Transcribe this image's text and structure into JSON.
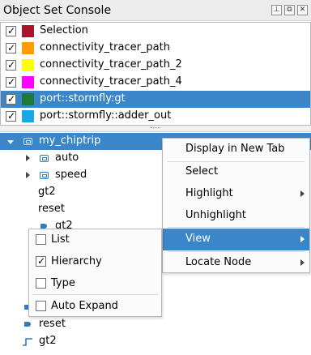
{
  "panel": {
    "title": "Object Set Console",
    "pin_glyph": "⊥",
    "float_glyph": "⧉",
    "close_glyph": "✕"
  },
  "object_sets": [
    {
      "label": "Selection",
      "checked": true,
      "color": "#a8142a",
      "selected": false
    },
    {
      "label": "connectivity_tracer_path",
      "checked": true,
      "color": "#ff9c00",
      "selected": false
    },
    {
      "label": "connectivity_tracer_path_2",
      "checked": true,
      "color": "#ffff00",
      "selected": false
    },
    {
      "label": "connectivity_tracer_path_4",
      "checked": true,
      "color": "#ff00ff",
      "selected": false
    },
    {
      "label": "port::stormfly:gt",
      "checked": true,
      "color": "#1f7a36",
      "selected": true
    },
    {
      "label": "port::stormfly::adder_out",
      "checked": true,
      "color": "#18a8e8",
      "selected": false
    }
  ],
  "tree": {
    "root": "my_chiptrip",
    "auto": "auto",
    "speed": "speed",
    "gt2": "gt2",
    "reset": "reset",
    "gt2_port": "gt2",
    "reset_port": "reset",
    "gt2_signal": "gt2"
  },
  "context_menu": {
    "display_new_tab": "Display in New Tab",
    "select": "Select",
    "highlight": "Highlight",
    "unhighlight": "Unhighlight",
    "view": "View",
    "locate_node": "Locate Node"
  },
  "view_submenu": {
    "list": {
      "label": "List",
      "checked": false
    },
    "hierarchy": {
      "label": "Hierarchy",
      "checked": true
    },
    "type": {
      "label": "Type",
      "checked": false
    },
    "auto_expand": {
      "label": "Auto Expand",
      "checked": false
    }
  },
  "check_glyph": "✓"
}
